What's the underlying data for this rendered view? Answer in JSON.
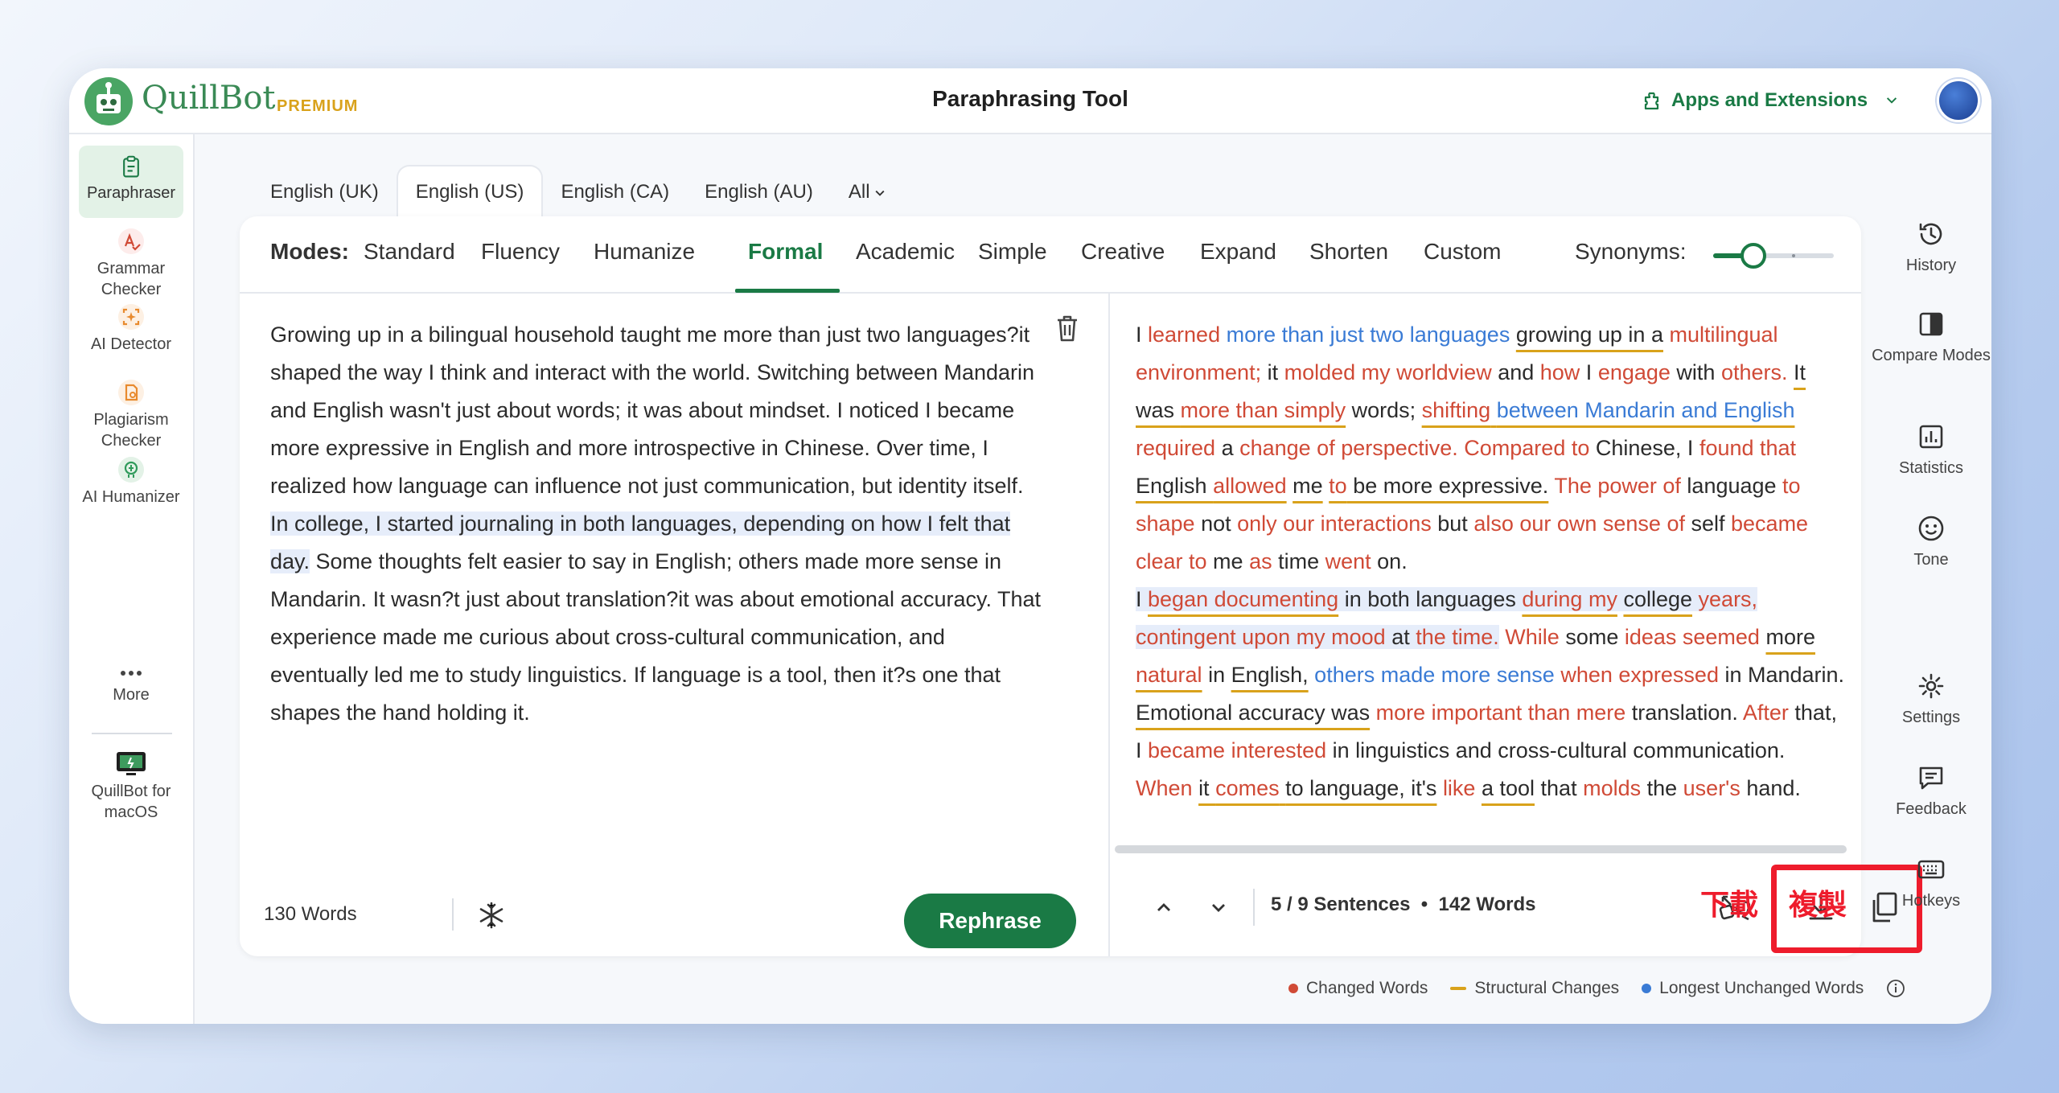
{
  "header": {
    "brand_name": "QuillBot",
    "brand_tier": "PREMIUM",
    "page_title": "Paraphrasing Tool",
    "apps_label": "Apps and Extensions"
  },
  "left_sidebar": {
    "items": [
      {
        "label": "Paraphraser",
        "icon": "paraphraser-icon",
        "active": true
      },
      {
        "label": "Grammar Checker",
        "icon": "grammar-checker-icon"
      },
      {
        "label": "AI Detector",
        "icon": "ai-detector-icon"
      },
      {
        "label": "Plagiarism Checker",
        "icon": "plagiarism-checker-icon"
      },
      {
        "label": "AI Humanizer",
        "icon": "ai-humanizer-icon"
      },
      {
        "label": "More",
        "icon": "more-icon"
      },
      {
        "label": "QuillBot for macOS",
        "icon": "macos-app-icon"
      }
    ]
  },
  "right_sidebar": {
    "items": [
      {
        "label": "History",
        "icon": "history-icon"
      },
      {
        "label": "Compare Modes",
        "icon": "compare-modes-icon"
      },
      {
        "label": "Statistics",
        "icon": "statistics-icon"
      },
      {
        "label": "Tone",
        "icon": "tone-icon"
      },
      {
        "label": "Settings",
        "icon": "settings-icon"
      },
      {
        "label": "Feedback",
        "icon": "feedback-icon"
      },
      {
        "label": "Hotkeys",
        "icon": "hotkeys-icon"
      }
    ]
  },
  "language_tabs": [
    "English (UK)",
    "English (US)",
    "English (CA)",
    "English (AU)",
    "All"
  ],
  "active_language": "English (US)",
  "modes": {
    "label": "Modes:",
    "items": [
      "Standard",
      "Fluency",
      "Humanize",
      "Formal",
      "Academic",
      "Simple",
      "Creative",
      "Expand",
      "Shorten",
      "Custom"
    ],
    "active": "Formal",
    "synonyms_label": "Synonyms:",
    "synonyms_level": 0.33
  },
  "input": {
    "para1": "Growing up in a bilingual household taught me more than just two languages?it shaped the way I think and interact with the world. Switching between Mandarin and English wasn't just about words; it was about mindset. I noticed I became more expressive in English and more introspective in Chinese. Over time, I realized how language can influence not just communication, but identity itself.",
    "para2_highlight": "In college, I started journaling in both languages, depending on how I felt that day.",
    "para2_rest": " Some thoughts felt easier to say in English; others made more sense in Mandarin. It wasn?t just about translation?it was about emotional accuracy. That experience made me curious about cross-cultural communication, and eventually led me to study linguistics. If language is a tool, then it?s one that shapes the hand holding it.",
    "word_count": "130 Words",
    "rephrase_label": "Rephrase"
  },
  "output": {
    "segments_p1": [
      {
        "t": "I ",
        "s": ""
      },
      {
        "t": "learned",
        "s": "c"
      },
      {
        "t": " ",
        "s": ""
      },
      {
        "t": "more than just two languages",
        "s": "b"
      },
      {
        "t": " ",
        "s": ""
      },
      {
        "t": "growing up in a",
        "s": "u"
      },
      {
        "t": " ",
        "s": ""
      },
      {
        "t": "multilingual environment;",
        "s": "c"
      },
      {
        "t": " it ",
        "s": ""
      },
      {
        "t": "molded my worldview",
        "s": "c"
      },
      {
        "t": " and ",
        "s": ""
      },
      {
        "t": "how",
        "s": "c"
      },
      {
        "t": " I ",
        "s": ""
      },
      {
        "t": "engage",
        "s": "c"
      },
      {
        "t": " with ",
        "s": ""
      },
      {
        "t": "others.",
        "s": "c"
      },
      {
        "t": " ",
        "s": ""
      },
      {
        "t": "It was ",
        "s": "u"
      },
      {
        "t": "more than simply",
        "s": "cu"
      },
      {
        "t": " words; ",
        "s": ""
      },
      {
        "t": "shifting",
        "s": "cu"
      },
      {
        "t": " ",
        "s": "u"
      },
      {
        "t": "between Mandarin and English",
        "s": "bu"
      },
      {
        "t": " ",
        "s": ""
      },
      {
        "t": "required",
        "s": "c"
      },
      {
        "t": " a ",
        "s": ""
      },
      {
        "t": "change of perspective. Compared to",
        "s": "c"
      },
      {
        "t": " Chinese, I ",
        "s": ""
      },
      {
        "t": "found that",
        "s": "c"
      },
      {
        "t": " ",
        "s": ""
      },
      {
        "t": "English ",
        "s": "u"
      },
      {
        "t": "allowed",
        "s": "cu"
      },
      {
        "t": " ",
        "s": ""
      },
      {
        "t": "me",
        "s": "u"
      },
      {
        "t": " ",
        "s": ""
      },
      {
        "t": "to",
        "s": "cu"
      },
      {
        "t": " be more expressive.",
        "s": "u"
      },
      {
        "t": " ",
        "s": ""
      },
      {
        "t": "The power of",
        "s": "c"
      },
      {
        "t": " language ",
        "s": ""
      },
      {
        "t": "to shape",
        "s": "c"
      },
      {
        "t": " not ",
        "s": ""
      },
      {
        "t": "only our interactions",
        "s": "c"
      },
      {
        "t": " but ",
        "s": ""
      },
      {
        "t": "also our own sense of",
        "s": "c"
      },
      {
        "t": " self ",
        "s": ""
      },
      {
        "t": "became clear to",
        "s": "c"
      },
      {
        "t": " me ",
        "s": ""
      },
      {
        "t": "as",
        "s": "c"
      },
      {
        "t": " time ",
        "s": ""
      },
      {
        "t": "went",
        "s": "c"
      },
      {
        "t": " on.",
        "s": ""
      }
    ],
    "segments_p2_highlight": [
      {
        "t": "I ",
        "s": ""
      },
      {
        "t": "began documenting",
        "s": "cu"
      },
      {
        "t": " in both languages ",
        "s": ""
      },
      {
        "t": "during my",
        "s": "cu"
      },
      {
        "t": " ",
        "s": ""
      },
      {
        "t": "college",
        "s": "u"
      },
      {
        "t": " ",
        "s": ""
      },
      {
        "t": "years, contingent upon my mood",
        "s": "c"
      },
      {
        "t": " at ",
        "s": ""
      },
      {
        "t": "the time.",
        "s": "c"
      }
    ],
    "segments_p2_rest": [
      {
        "t": " ",
        "s": ""
      },
      {
        "t": "While",
        "s": "c"
      },
      {
        "t": " some ",
        "s": ""
      },
      {
        "t": "ideas seemed",
        "s": "c"
      },
      {
        "t": " ",
        "s": ""
      },
      {
        "t": "more",
        "s": "u"
      },
      {
        "t": " ",
        "s": ""
      },
      {
        "t": "natural",
        "s": "cu"
      },
      {
        "t": " in ",
        "s": ""
      },
      {
        "t": "English,",
        "s": "u"
      },
      {
        "t": " ",
        "s": ""
      },
      {
        "t": "others made more sense",
        "s": "b"
      },
      {
        "t": " ",
        "s": ""
      },
      {
        "t": "when expressed",
        "s": "c"
      },
      {
        "t": " in Mandarin. ",
        "s": ""
      },
      {
        "t": "Emotional accuracy was",
        "s": "u"
      },
      {
        "t": " ",
        "s": ""
      },
      {
        "t": "more important than mere",
        "s": "c"
      },
      {
        "t": " translation. ",
        "s": ""
      },
      {
        "t": "After",
        "s": "c"
      },
      {
        "t": " that, I ",
        "s": ""
      },
      {
        "t": "became interested",
        "s": "c"
      },
      {
        "t": " in linguistics and cross-cultural communication. ",
        "s": ""
      },
      {
        "t": "When",
        "s": "c"
      },
      {
        "t": " ",
        "s": ""
      },
      {
        "t": "it ",
        "s": "u"
      },
      {
        "t": "comes",
        "s": "cu"
      },
      {
        "t": " ",
        "s": "u"
      },
      {
        "t": "to language, it's",
        "s": "u"
      },
      {
        "t": " ",
        "s": ""
      },
      {
        "t": "like",
        "s": "c"
      },
      {
        "t": " ",
        "s": ""
      },
      {
        "t": "a tool",
        "s": "u"
      },
      {
        "t": " that ",
        "s": ""
      },
      {
        "t": "molds",
        "s": "c"
      },
      {
        "t": " the ",
        "s": ""
      },
      {
        "t": "user's",
        "s": "c"
      },
      {
        "t": " hand.",
        "s": ""
      }
    ],
    "sentences_info": "5 / 9 Sentences",
    "word_count": "142 Words"
  },
  "annotations": {
    "download": "下載",
    "copy": "複製"
  },
  "legend": {
    "changed": "Changed Words",
    "structural": "Structural Changes",
    "unchanged": "Longest Unchanged Words"
  },
  "colors": {
    "brand_green": "#1a7a45",
    "changed_red": "#d04a36",
    "structural_yellow": "#d9a21b",
    "unchanged_blue": "#3a7bd5",
    "annotation_red": "#ee1c2c"
  }
}
